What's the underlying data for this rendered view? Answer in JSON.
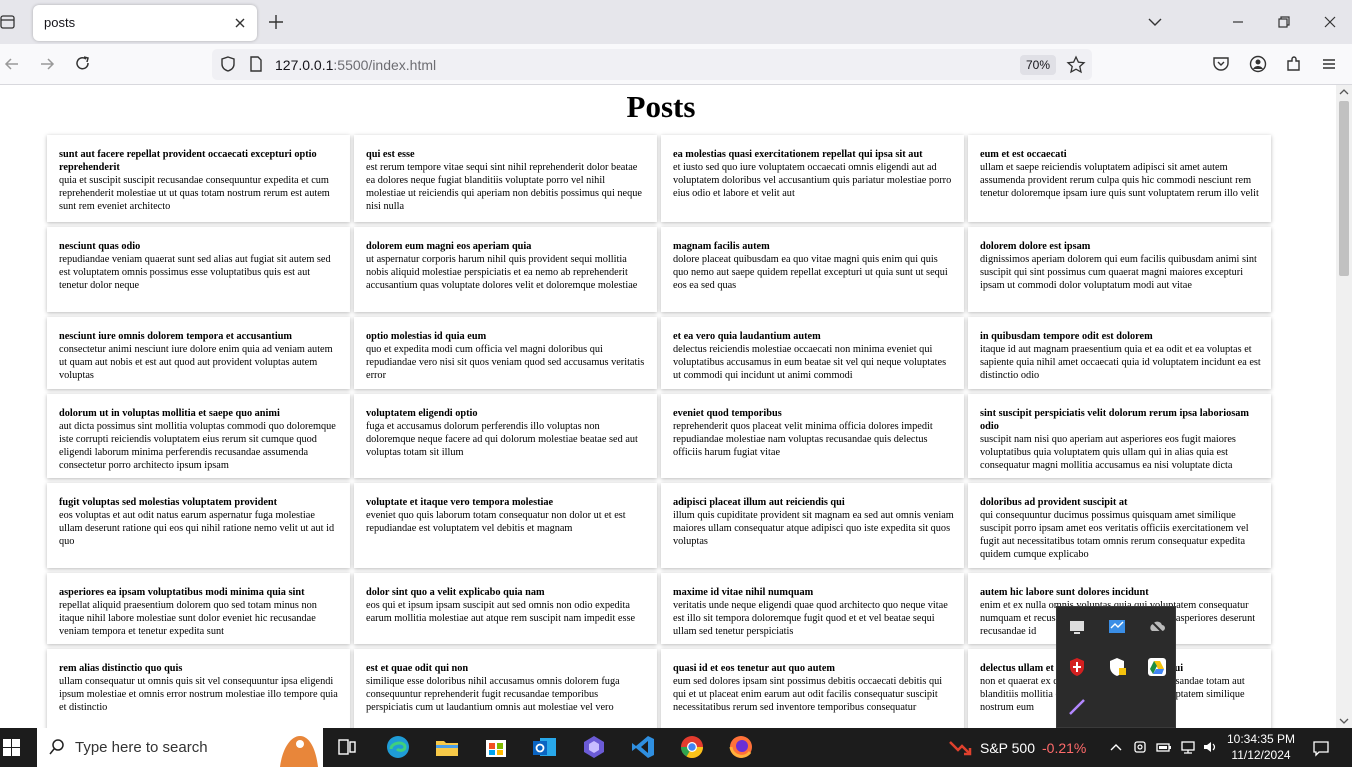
{
  "browser": {
    "tab_title": "posts",
    "url_host": "127.0.0.1",
    "url_rest": ":5500/index.html",
    "zoom": "70%"
  },
  "page": {
    "title": "Posts",
    "posts": [
      {
        "title": "sunt aut facere repellat provident occaecati excepturi optio reprehenderit",
        "body": "quia et suscipit suscipit recusandae consequuntur expedita et cum reprehenderit molestiae ut ut quas totam nostrum rerum est autem sunt rem eveniet architecto"
      },
      {
        "title": "qui est esse",
        "body": "est rerum tempore vitae sequi sint nihil reprehenderit dolor beatae ea dolores neque fugiat blanditiis voluptate porro vel nihil molestiae ut reiciendis qui aperiam non debitis possimus qui neque nisi nulla"
      },
      {
        "title": "ea molestias quasi exercitationem repellat qui ipsa sit aut",
        "body": "et iusto sed quo iure voluptatem occaecati omnis eligendi aut ad voluptatem doloribus vel accusantium quis pariatur molestiae porro eius odio et labore et velit aut"
      },
      {
        "title": "eum et est occaecati",
        "body": "ullam et saepe reiciendis voluptatem adipisci sit amet autem assumenda provident rerum culpa quis hic commodi nesciunt rem tenetur doloremque ipsam iure quis sunt voluptatem rerum illo velit"
      },
      {
        "title": "nesciunt quas odio",
        "body": "repudiandae veniam quaerat sunt sed alias aut fugiat sit autem sed est voluptatem omnis possimus esse voluptatibus quis est aut tenetur dolor neque"
      },
      {
        "title": "dolorem eum magni eos aperiam quia",
        "body": "ut aspernatur corporis harum nihil quis provident sequi mollitia nobis aliquid molestiae perspiciatis et ea nemo ab reprehenderit accusantium quas voluptate dolores velit et doloremque molestiae"
      },
      {
        "title": "magnam facilis autem",
        "body": "dolore placeat quibusdam ea quo vitae magni quis enim qui quis quo nemo aut saepe quidem repellat excepturi ut quia sunt ut sequi eos ea sed quas"
      },
      {
        "title": "dolorem dolore est ipsam",
        "body": "dignissimos aperiam dolorem qui eum facilis quibusdam animi sint suscipit qui sint possimus cum quaerat magni maiores excepturi ipsam ut commodi dolor voluptatum modi aut vitae"
      },
      {
        "title": "nesciunt iure omnis dolorem tempora et accusantium",
        "body": "consectetur animi nesciunt iure dolore enim quia ad veniam autem ut quam aut nobis et est aut quod aut provident voluptas autem voluptas"
      },
      {
        "title": "optio molestias id quia eum",
        "body": "quo et expedita modi cum officia vel magni doloribus qui repudiandae vero nisi sit quos veniam quod sed accusamus veritatis error"
      },
      {
        "title": "et ea vero quia laudantium autem",
        "body": "delectus reiciendis molestiae occaecati non minima eveniet qui voluptatibus accusamus in eum beatae sit vel qui neque voluptates ut commodi qui incidunt ut animi commodi"
      },
      {
        "title": "in quibusdam tempore odit est dolorem",
        "body": "itaque id aut magnam praesentium quia et ea odit et ea voluptas et sapiente quia nihil amet occaecati quia id voluptatem incidunt ea est distinctio odio"
      },
      {
        "title": "dolorum ut in voluptas mollitia et saepe quo animi",
        "body": "aut dicta possimus sint mollitia voluptas commodi quo doloremque iste corrupti reiciendis voluptatem eius rerum sit cumque quod eligendi laborum minima perferendis recusandae assumenda consectetur porro architecto ipsum ipsam"
      },
      {
        "title": "voluptatem eligendi optio",
        "body": "fuga et accusamus dolorum perferendis illo voluptas non doloremque neque facere ad qui dolorum molestiae beatae sed aut voluptas totam sit illum"
      },
      {
        "title": "eveniet quod temporibus",
        "body": "reprehenderit quos placeat velit minima officia dolores impedit repudiandae molestiae nam voluptas recusandae quis delectus officiis harum fugiat vitae"
      },
      {
        "title": "sint suscipit perspiciatis velit dolorum rerum ipsa laboriosam odio",
        "body": "suscipit nam nisi quo aperiam aut asperiores eos fugit maiores voluptatibus quia voluptatem quis ullam qui in alias quia est consequatur magni mollitia accusamus ea nisi voluptate dicta"
      },
      {
        "title": "fugit voluptas sed molestias voluptatem provident",
        "body": "eos voluptas et aut odit natus earum aspernatur fuga molestiae ullam deserunt ratione qui eos qui nihil ratione nemo velit ut aut id quo"
      },
      {
        "title": "voluptate et itaque vero tempora molestiae",
        "body": "eveniet quo quis laborum totam consequatur non dolor ut et est repudiandae est voluptatem vel debitis et magnam"
      },
      {
        "title": "adipisci placeat illum aut reiciendis qui",
        "body": "illum quis cupiditate provident sit magnam ea sed aut omnis veniam maiores ullam consequatur atque adipisci quo iste expedita sit quos voluptas"
      },
      {
        "title": "doloribus ad provident suscipit at",
        "body": "qui consequuntur ducimus possimus quisquam amet similique suscipit porro ipsam amet eos veritatis officiis exercitationem vel fugit aut necessitatibus totam omnis rerum consequatur expedita quidem cumque explicabo"
      },
      {
        "title": "asperiores ea ipsam voluptatibus modi minima quia sint",
        "body": "repellat aliquid praesentium dolorem quo sed totam minus non itaque nihil labore molestiae sunt dolor eveniet hic recusandae veniam tempora et tenetur expedita sunt"
      },
      {
        "title": "dolor sint quo a velit explicabo quia nam",
        "body": "eos qui et ipsum ipsam suscipit aut sed omnis non odio expedita earum mollitia molestiae aut atque rem suscipit nam impedit esse"
      },
      {
        "title": "maxime id vitae nihil numquam",
        "body": "veritatis unde neque eligendi quae quod architecto quo neque vitae est illo sit tempora doloremque fugit quod et et vel beatae sequi ullam sed tenetur perspiciatis"
      },
      {
        "title": "autem hic labore sunt dolores incidunt",
        "body": "enim et ex nulla omnis voluptas quia qui voluptatem consequatur numquam et recusandae id dignissimos aut sed asperiores deserunt recusandae id"
      },
      {
        "title": "rem alias distinctio quo quis",
        "body": "ullam consequatur ut omnis quis sit vel consequuntur ipsa eligendi ipsum molestiae et omnis error nostrum molestiae illo tempore quia et distinctio"
      },
      {
        "title": "est et quae odit qui non",
        "body": "similique esse doloribus nihil accusamus omnis dolorem fuga consequuntur reprehenderit fugit recusandae temporibus perspiciatis cum ut laudantium omnis aut molestiae vel vero"
      },
      {
        "title": "quasi id et eos tenetur aut quo autem",
        "body": "eum sed dolores ipsam sint possimus debitis occaecati debitis qui qui et ut placeat enim earum aut odit facilis consequatur suscipit necessitatibus rerum sed inventore temporibus consequatur"
      },
      {
        "title": "delectus ullam et corporis nulla voluptas sequi",
        "body": "non et quaerat ex quae ad maiores maiores recusandae totam aut blanditiis mollitia quas illo ut voluptatibus voluptatem similique nostrum eum"
      }
    ]
  },
  "taskbar": {
    "search_placeholder": "Type here to search",
    "stock_name": "S&P 500",
    "stock_change": "-0.21%",
    "time": "10:34:35 PM",
    "date": "11/12/2024"
  }
}
